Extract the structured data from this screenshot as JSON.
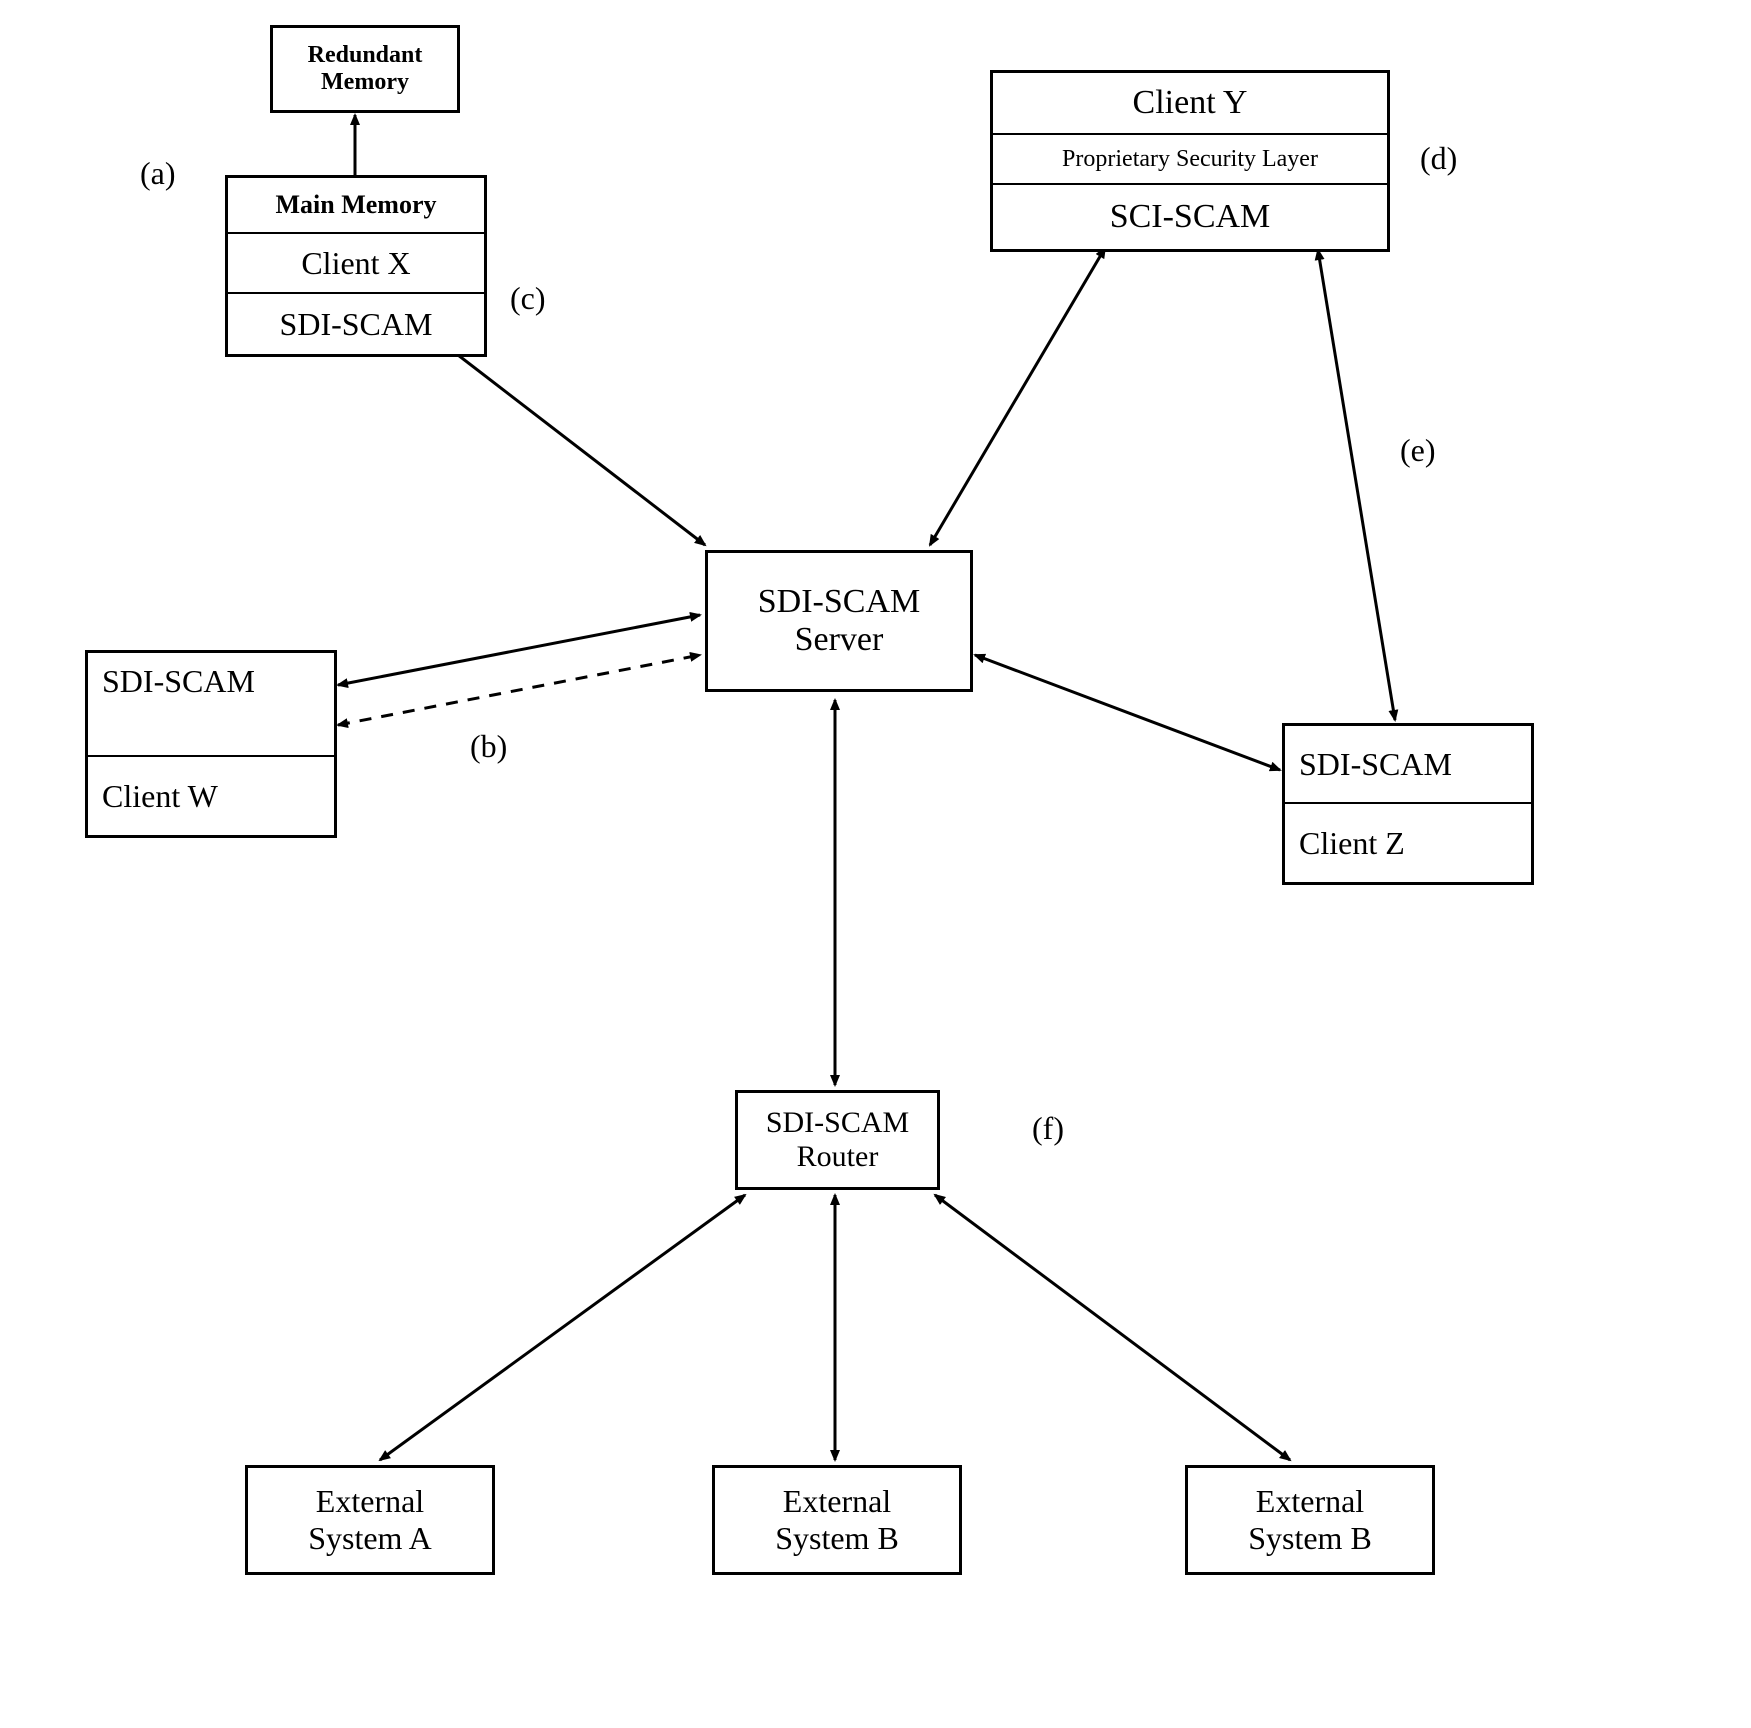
{
  "nodes": {
    "redundant_memory": "Redundant\nMemory",
    "main_memory": "Main Memory",
    "client_x": "Client X",
    "sdi_scam_x": "SDI-SCAM",
    "client_y": "Client Y",
    "proprietary_security": "Proprietary Security Layer",
    "sci_scam": "SCI-SCAM",
    "server": "SDI-SCAM\nServer",
    "sdi_scam_w": "SDI-SCAM",
    "client_w": "Client W",
    "sdi_scam_z": "SDI-SCAM",
    "client_z": "Client Z",
    "router": "SDI-SCAM\nRouter",
    "ext_a": "External\nSystem A",
    "ext_b": "External\nSystem B",
    "ext_b2": "External\nSystem B"
  },
  "annotations": {
    "a": "(a)",
    "b": "(b)",
    "c": "(c)",
    "d": "(d)",
    "e": "(e)",
    "f": "(f)"
  }
}
